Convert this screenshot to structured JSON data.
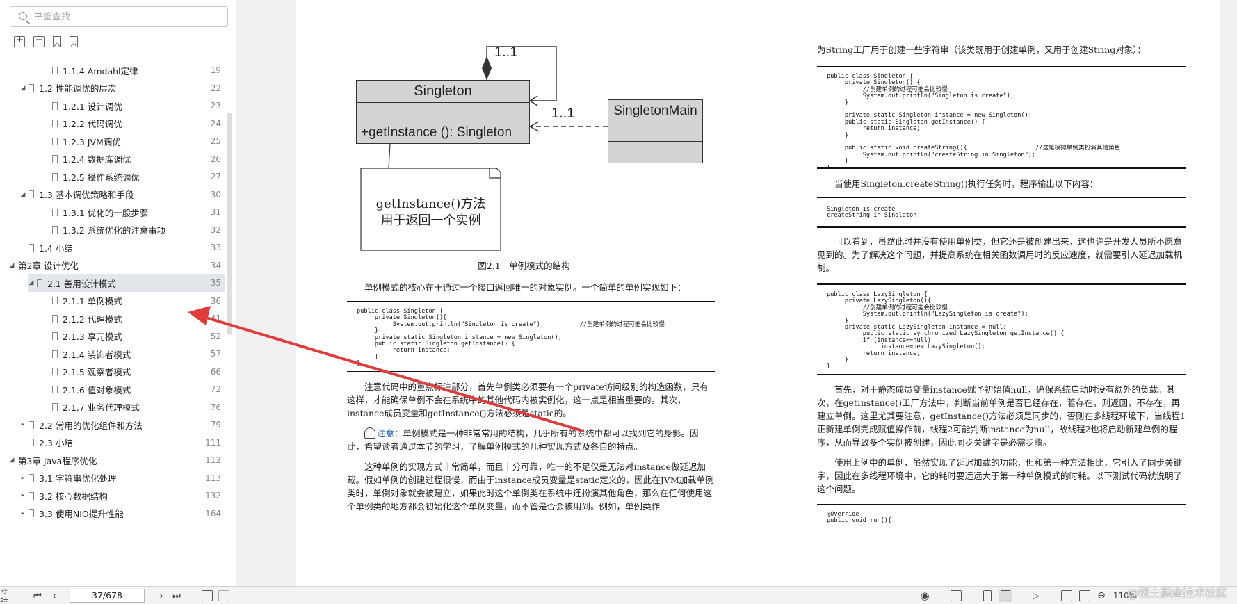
{
  "sidebar": {
    "search_placeholder": "书签查找",
    "toc": [
      {
        "label": "1.1.4 Amdahl定律",
        "page": "19",
        "level": 3,
        "arrow": ""
      },
      {
        "label": "1.2 性能调优的层次",
        "page": "22",
        "level": 2,
        "arrow": "◢"
      },
      {
        "label": "1.2.1 设计调优",
        "page": "23",
        "level": 3,
        "arrow": ""
      },
      {
        "label": "1.2.2 代码调优",
        "page": "24",
        "level": 3,
        "arrow": ""
      },
      {
        "label": "1.2.3 JVM调优",
        "page": "25",
        "level": 3,
        "arrow": ""
      },
      {
        "label": "1.2.4 数据库调优",
        "page": "26",
        "level": 3,
        "arrow": ""
      },
      {
        "label": "1.2.5 操作系统调优",
        "page": "27",
        "level": 3,
        "arrow": ""
      },
      {
        "label": "1.3 基本调优策略和手段",
        "page": "30",
        "level": 2,
        "arrow": "◢"
      },
      {
        "label": "1.3.1 优化的一般步骤",
        "page": "31",
        "level": 3,
        "arrow": ""
      },
      {
        "label": "1.3.2 系统优化的注意事项",
        "page": "32",
        "level": 3,
        "arrow": ""
      },
      {
        "label": "1.4 小结",
        "page": "33",
        "level": 2,
        "arrow": ""
      },
      {
        "label": "第2章 设计优化",
        "page": "34",
        "level": 1,
        "arrow": "◢"
      },
      {
        "label": "2.1 善用设计模式",
        "page": "35",
        "level": 2,
        "arrow": "◢",
        "selected": true
      },
      {
        "label": "2.1.1 单例模式",
        "page": "36",
        "level": 3,
        "arrow": ""
      },
      {
        "label": "2.1.2 代理模式",
        "page": "41",
        "level": 3,
        "arrow": ""
      },
      {
        "label": "2.1.3 享元模式",
        "page": "52",
        "level": 3,
        "arrow": ""
      },
      {
        "label": "2.1.4 装饰者模式",
        "page": "57",
        "level": 3,
        "arrow": ""
      },
      {
        "label": "2.1.5 观察者模式",
        "page": "66",
        "level": 3,
        "arrow": ""
      },
      {
        "label": "2.1.6 值对象模式",
        "page": "72",
        "level": 3,
        "arrow": ""
      },
      {
        "label": "2.1.7 业务代理模式",
        "page": "76",
        "level": 3,
        "arrow": ""
      },
      {
        "label": "2.2 常用的优化组件和方法",
        "page": "79",
        "level": 2,
        "arrow": "▸"
      },
      {
        "label": "2.3 小结",
        "page": "111",
        "level": 2,
        "arrow": ""
      },
      {
        "label": "第3章 Java程序优化",
        "page": "112",
        "level": 1,
        "arrow": "◢"
      },
      {
        "label": "3.1 字符串优化处理",
        "page": "113",
        "level": 2,
        "arrow": "▸"
      },
      {
        "label": "3.2 核心数据结构",
        "page": "132",
        "level": 2,
        "arrow": "▸"
      },
      {
        "label": "3.3 使用NIO提升性能",
        "page": "164",
        "level": 2,
        "arrow": "▸"
      }
    ]
  },
  "diagram": {
    "class_name": "Singleton",
    "method": "+getInstance (): Singleton",
    "multiplicity_self": "1..1",
    "multiplicity_dep": "1..1",
    "main_class": "SingletonMain",
    "note_line1": "getInstance()方法",
    "note_line2": "用于返回一个实例",
    "caption": "图2.1　单例模式的结构"
  },
  "left_col": {
    "intro": "单例模式的核心在于通过一个接口返回唯一的对象实例。一个简单的单例实现如下：",
    "code1": "public class Singleton {\n     private Singleton(){\n          System.out.println(\"Singleton is create\");          //创建单例的过程可能会比较慢\n     }\n     private static Singleton instance = new Singleton();\n     public static Singleton getInstance() {\n          return instance;\n     }\n}",
    "p1": "注意代码中的重点标注部分，首先单例类必须要有一个private访问级别的构造函数，只有这样，才能确保单例不会在系统中的其他代码内被实例化，这一点是相当重要的。其次，instance成员变量和getInstance()方法必须是static的。",
    "note_label": "注意：",
    "note_text": "单例模式是一种非常常用的结构，几乎所有的系统中都可以找到它的身影。因此，希望读者通过本节的学习，了解单例模式的几种实现方式及各自的特点。",
    "p2": "这种单例的实现方式非常简单，而且十分可靠，唯一的不足仅是无法对instance做延迟加载。假如单例的创建过程很慢，而由于instance成员变量是static定义的，因此在JVM加载单例类时，单例对象就会被建立，如果此时这个单例类在系统中还扮演其他角色，那么在任何使用这个单例类的地方都会初始化这个单例变量，而不管是否会被用到。例如，单例类作"
  },
  "right_col": {
    "top": "为String工厂用于创建一些字符串（该类既用于创建单例，又用于创建String对象）：",
    "code1": "public class Singleton {\n     private Singleton() {\n          //创建单例的过程可能会比较慢\n          System.out.println(\"Singleton is create\");\n     }\n\n     private static Singleton instance = new Singleton();\n     public static Singleton getInstance() {\n          return instance;\n     }\n\n     public static void createString(){                   //这是模拟单例类扮演其他角色\n          System.out.println(\"createString in Singleton\");\n     }\n}",
    "p1": "当使用Singleton.createString()执行任务时，程序输出以下内容：",
    "code2": "Singleton is create\ncreateString in Singleton",
    "p2": "可以看到，虽然此时并没有使用单例类，但它还是被创建出来，这也许是开发人员所不愿意见到的。为了解决这个问题，并提高系统在相关函数调用时的反应速度，就需要引入延迟加载机制。",
    "code3": "public class LazySingleton {\n     private LazySingleton(){\n          //创建单例的过程可能会比较慢\n          System.out.println(\"LazySingleton is create\");\n     }\n     private static LazySingleton instance = null;\n          public static synchronized LazySingleton getInstance() {\n          if (instance==null)\n               instance=new LazySingleton();\n          return instance;\n     }\n}",
    "p3": "首先，对于静态成员变量instance赋予初始值null，确保系统启动时没有额外的负载。其次，在getInstance()工厂方法中，判断当前单例是否已经存在，若存在，则返回，不存在，再建立单例。这里尤其要注意，getInstance()方法必须是同步的，否则在多线程环境下，当线程1正新建单例完成赋值操作前，线程2可能判断instance为null，故线程2也将启动新建单例的程序，从而导致多个实例被创建，因此同步关键字是必需步骤。",
    "p4": "使用上例中的单例，虽然实现了延迟加载的功能，但和第一种方法相比，它引入了同步关键字，因此在多线程环境中，它的耗时要远远大于第一种单例模式的时耗。以下测试代码就说明了这个问题。",
    "code4": "@Override\npublic void run(){"
  },
  "statusbar": {
    "nav_label": "导航",
    "page_indicator": "37/678",
    "zoom": "110%",
    "watermark": "@稀土掘金技术社区"
  },
  "colors": {
    "arrow": "#e03c3c",
    "selection": "#e2e6ea",
    "uml_fill": "#d4d4d4"
  }
}
